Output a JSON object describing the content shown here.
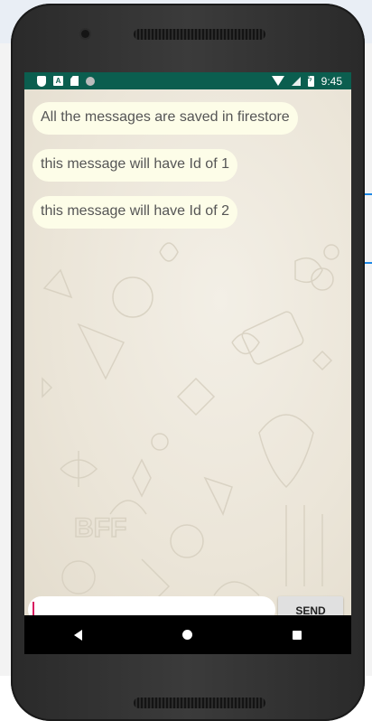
{
  "status_bar": {
    "time": "9:45",
    "left_icons": [
      "shield-icon",
      "a-icon",
      "sd-card-icon",
      "circle-icon"
    ],
    "right_icons": [
      "wifi-icon",
      "signal-icon",
      "battery-charging-icon"
    ],
    "color": "#0b5e4f"
  },
  "messages": [
    {
      "text": "All the messages are saved in firestore"
    },
    {
      "text": "this message will have Id of 1"
    },
    {
      "text": "this message will have Id of 2"
    }
  ],
  "composer": {
    "input_value": "",
    "placeholder": "",
    "send_label": "SEND"
  },
  "nav": {
    "icons": [
      "back-icon",
      "home-icon",
      "recents-icon"
    ]
  }
}
